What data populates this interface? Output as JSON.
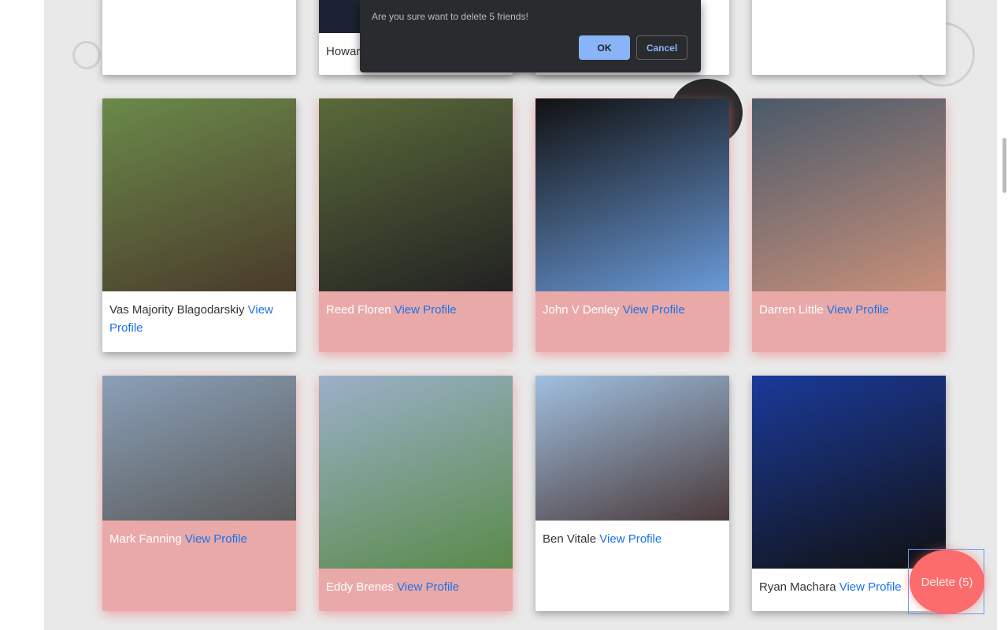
{
  "dialog": {
    "message": "Are you sure want to delete 5 friends!",
    "ok": "OK",
    "cancel": "Cancel"
  },
  "view_label": "View Profile",
  "top_row": [
    {
      "name": "",
      "selected": false
    },
    {
      "name": "Howar",
      "selected": false
    },
    {
      "name": "",
      "selected": false
    },
    {
      "name": "",
      "selected": false
    }
  ],
  "friends": [
    {
      "name": "Vas Majority Blagodarskiy",
      "selected": false,
      "photo": [
        "#6a8a4a",
        "#4a3a2a"
      ]
    },
    {
      "name": "Reed Floren",
      "selected": true,
      "photo": [
        "#5a6a3a",
        "#222"
      ]
    },
    {
      "name": "John V Denley",
      "selected": true,
      "photo": [
        "#111",
        "#6a9ad8"
      ]
    },
    {
      "name": "Darren Little",
      "selected": true,
      "photo": [
        "#4a5a6a",
        "#c8907a"
      ]
    },
    {
      "name": "Mark Fanning",
      "selected": true,
      "photo": [
        "#8aa0b8",
        "#5a5a5a"
      ]
    },
    {
      "name": "Eddy Brenes",
      "selected": true,
      "photo": [
        "#9ab0c8",
        "#5a8a4a"
      ]
    },
    {
      "name": "Ben Vitale",
      "selected": false,
      "photo": [
        "#a0c0e0",
        "#4a3a3a"
      ]
    },
    {
      "name": "Ryan Machara",
      "selected": false,
      "photo": [
        "#1a3a9a",
        "#111"
      ]
    }
  ],
  "delete_button": "Delete (5)"
}
